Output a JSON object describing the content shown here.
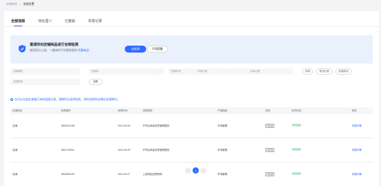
{
  "breadcrumb": {
    "parent": "店铺体检",
    "sep": ">",
    "current": "违规处置"
  },
  "tabs": [
    {
      "label": "全部违规",
      "count": ""
    },
    {
      "label": "待处理",
      "count": "0"
    },
    {
      "label": "已撤销",
      "count": ""
    },
    {
      "label": "举报记录",
      "count": ""
    }
  ],
  "banner": {
    "title": "邀请你对店铺商品进行合规检测",
    "desc_prefix": "使用官方工具，一键体检平台规则里的",
    "desc_link": "\"问题商品\"",
    "primary_btn": "去检测",
    "secondary_btn": "不再提醒"
  },
  "filters": {
    "f1": "违规编号",
    "f2": "请选择",
    "f3": "违规时间",
    "f3_start": "开始日期",
    "f3_end": "结束日期",
    "f4": "违规类型",
    "query_btn": "查询",
    "reset_btn": "重置",
    "export_btn": "导出记录",
    "export2_btn": "批量导出",
    "date_sep": "~"
  },
  "notice": "仅可以在此处查看已有的违规记录，超期时记录将消失，您的违规申诉需在处理期内。",
  "table": {
    "headers": [
      "店铺信息",
      "违规编号",
      "违规时间",
      "违规类型",
      "严重程度",
      "状态",
      "处罚状态",
      "操作"
    ],
    "rows": [
      {
        "shop": "店铺",
        "id": "3840910248",
        "date": "2024-05-09",
        "type": "不符合商品标签管理规则",
        "level": "市场管理",
        "status": "待处理",
        "result": "处罚完成",
        "action": "查看详情"
      },
      {
        "shop": "店铺",
        "id": "3832725921",
        "date": "2024-05-29",
        "type": "不符合商品标签管理规则",
        "level": "市场管理",
        "status": "待处理",
        "result": "处罚完成",
        "action": "查看详情"
      },
      {
        "shop": "店铺",
        "id": "3840654153",
        "date": "2024-05-27",
        "type": "上架商品违规规则",
        "level": "市场管理",
        "status": "待处理",
        "result": "处罚完成",
        "action": "查看详情"
      }
    ]
  },
  "pagination": {
    "prev": "‹",
    "current": "1",
    "next": "›"
  },
  "colors": {
    "accent": "#2f6bff",
    "success": "#2bb06a",
    "danger": "#e54545"
  }
}
